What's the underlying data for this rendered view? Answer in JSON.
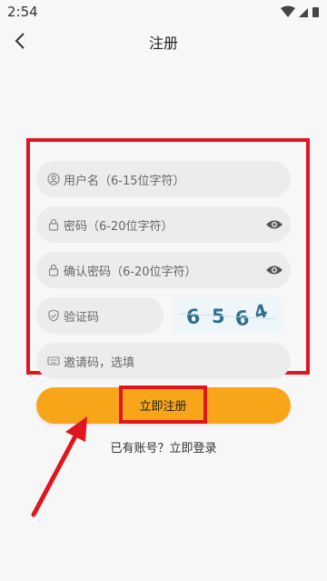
{
  "status_bar": {
    "time": "2:54"
  },
  "header": {
    "title": "注册"
  },
  "form": {
    "username_placeholder": "用户名（6-15位字符）",
    "password_placeholder": "密码（6-20位字符）",
    "confirm_placeholder": "确认密码（6-20位字符）",
    "captcha_placeholder": "验证码",
    "captcha_code": "6564",
    "invite_placeholder": "邀请码，选填"
  },
  "actions": {
    "register_label": "立即注册",
    "login_text": "已有账号？立即登录"
  },
  "colors": {
    "accent": "#f9a51a",
    "highlight": "#e0161e"
  }
}
